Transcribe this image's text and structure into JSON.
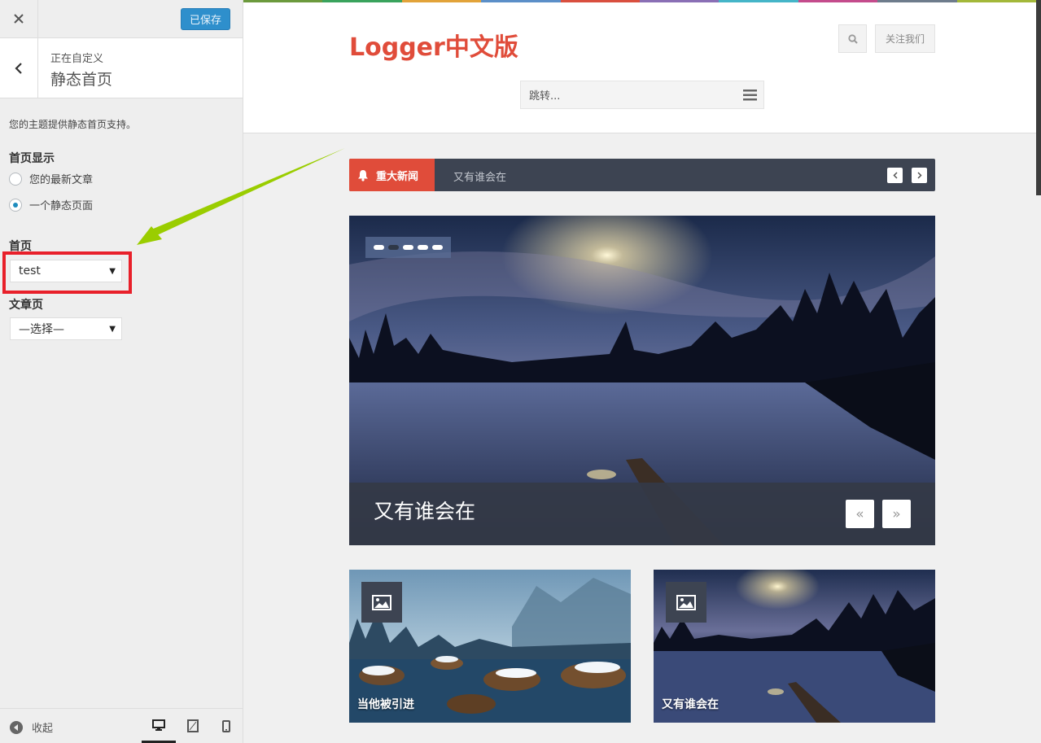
{
  "sidebar": {
    "saved_label": "已保存",
    "customizing_label": "正在自定义",
    "section_title": "静态首页",
    "description": "您的主题提供静态首页支持。",
    "homepage_display": {
      "title": "首页显示",
      "options": [
        {
          "label": "您的最新文章",
          "checked": false
        },
        {
          "label": "一个静态页面",
          "checked": true
        }
      ]
    },
    "front_page": {
      "title": "首页",
      "selected": "test"
    },
    "posts_page": {
      "title": "文章页",
      "selected": "—选择—"
    },
    "collapse_label": "收起",
    "devices": [
      "desktop-icon",
      "tablet-icon",
      "mobile-icon"
    ],
    "active_device": "desktop"
  },
  "preview": {
    "site_title": "Logger中文版",
    "follow_label": "关注我们",
    "jump_placeholder": "跳转...",
    "ticker": {
      "label": "重大新闻",
      "text": "又有谁会在"
    },
    "slider": {
      "caption": "又有谁会在",
      "slide_count": 5,
      "active_slide": 2
    },
    "cards": [
      {
        "title": "当他被引进"
      },
      {
        "title": "又有谁会在"
      }
    ]
  },
  "colors": {
    "accent_red": "#e04c3a",
    "save_blue": "#2e8fcc",
    "dark_slate": "#3d4452",
    "highlight_red": "#e8202a",
    "arrow_green": "#9acd00"
  }
}
